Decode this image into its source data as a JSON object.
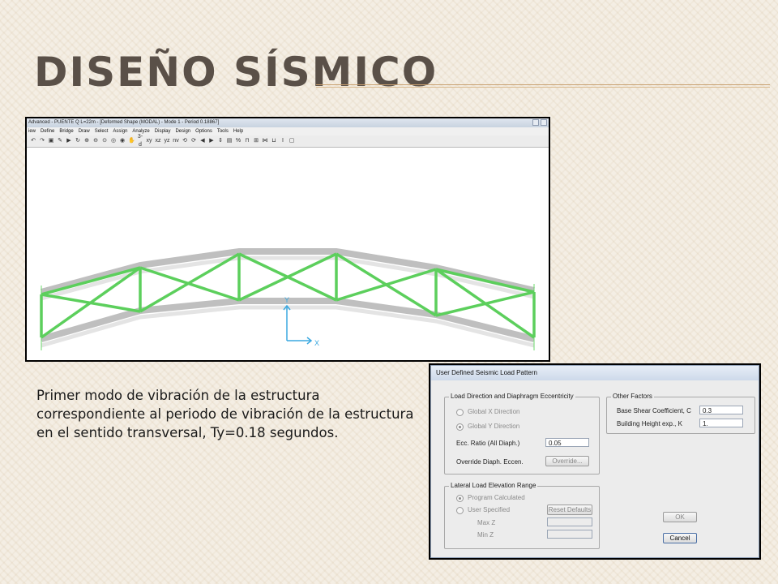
{
  "slide": {
    "title": "DISEÑO SÍSMICO",
    "description": "Primer modo de vibración de la estructura correspondiente al periodo de vibración de la estructura en el sentido transversal, Ty=0.18 segundos."
  },
  "sap_window": {
    "title": "Advanced  - PUENTE Q L=22m - [Deformed Shape (MODAL) - Mode 1 - Period 0.18867]",
    "menu": [
      "iew",
      "Define",
      "Bridge",
      "Draw",
      "Select",
      "Assign",
      "Analyze",
      "Display",
      "Design",
      "Options",
      "Tools",
      "Help"
    ],
    "toolbar_icons": [
      "undo-icon",
      "redo-icon",
      "lock-icon",
      "pencil-icon",
      "run-icon",
      "rotate-icon",
      "zoom-in-icon",
      "zoom-out-icon",
      "zoom-window-icon",
      "zoom-prev-icon",
      "zoom-next-icon",
      "pan-icon",
      "3d-view-icon",
      "xy-view-icon",
      "xz-view-icon",
      "yz-view-icon",
      "nv-view-icon",
      "rotate3d-icon",
      "refresh-icon",
      "up-icon",
      "down-icon",
      "select-icon",
      "deformed-icon",
      "percent-icon",
      "frame-icon",
      "area-icon",
      "link-icon",
      "cable-icon",
      "text-icon",
      "display-icon"
    ],
    "toolbar_labels": [
      "3-d",
      "xy",
      "xz",
      "yz",
      "nv",
      "%"
    ],
    "axis_y": "Y",
    "axis_x": "X",
    "accent_structure": "#d6d6d6",
    "accent_mode_shape": "#5ccf5c"
  },
  "dialog": {
    "title": "User Defined Seismic Load Pattern",
    "load_direction": {
      "group_title": "Load Direction and Diaphragm Eccentricity",
      "option_x": "Global  X  Direction",
      "option_y": "Global  Y  Direction",
      "ecc_label": "Ecc. Ratio (All Diaph.)",
      "ecc_value": "0.05",
      "override_label": "Override Diaph. Eccen.",
      "override_button": "Override..."
    },
    "other_factors": {
      "group_title": "Other Factors",
      "base_shear_label": "Base Shear Coefficient, C",
      "base_shear_value": "0.3",
      "building_height_label": "Building Height exp., K",
      "building_height_value": "1."
    },
    "lateral_range": {
      "group_title": "Lateral Load Elevation Range",
      "option_program": "Program Calculated",
      "option_user": "User Specified",
      "reset_button": "Reset Defaults",
      "max_z_label": "Max Z",
      "min_z_label": "Min Z"
    },
    "ok_button": "OK",
    "cancel_button": "Cancel"
  }
}
